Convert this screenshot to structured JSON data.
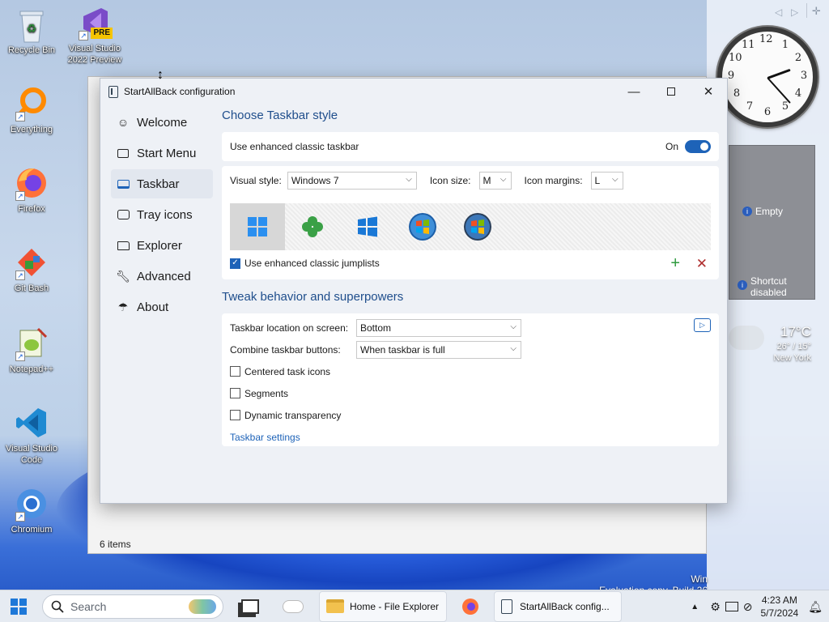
{
  "desktop": {
    "icons": [
      {
        "label": "Recycle Bin"
      },
      {
        "label": "Visual Studio 2022 Preview",
        "badge": "PRE"
      },
      {
        "label": "Everything"
      },
      {
        "label": "Firefox"
      },
      {
        "label": "Git Bash"
      },
      {
        "label": "Notepad++"
      },
      {
        "label": "Visual Studio Code"
      },
      {
        "label": "Chromium"
      }
    ],
    "watermark_line1": "Win",
    "watermark_line2": "Evaluation copy. Build 26"
  },
  "gadgets": {
    "clock_numbers": [
      "12",
      "1",
      "2",
      "3",
      "4",
      "5",
      "6",
      "7",
      "8",
      "9",
      "10",
      "11"
    ],
    "slideshow_empty": "Empty",
    "slideshow_shortcut": "Shortcut disabled",
    "weather_temp": "17°C",
    "weather_range": "26° / 15°",
    "weather_city": "New York"
  },
  "explorer_back": {
    "status": "6 items"
  },
  "window": {
    "title": "StartAllBack configuration",
    "nav": [
      {
        "label": "Welcome",
        "icon": "smiley-icon"
      },
      {
        "label": "Start Menu",
        "icon": "start-menu-icon"
      },
      {
        "label": "Taskbar",
        "icon": "taskbar-icon"
      },
      {
        "label": "Tray icons",
        "icon": "tray-icon"
      },
      {
        "label": "Explorer",
        "icon": "folder-icon"
      },
      {
        "label": "Advanced",
        "icon": "wrench-icon"
      },
      {
        "label": "About",
        "icon": "umbrella-icon"
      }
    ],
    "active_nav": "Taskbar",
    "section1_title": "Choose Taskbar style",
    "enhanced_label": "Use enhanced classic taskbar",
    "enhanced_state": "On",
    "visual_style_label": "Visual style:",
    "visual_style_value": "Windows 7",
    "icon_size_label": "Icon size:",
    "icon_size_value": "M",
    "icon_margins_label": "Icon margins:",
    "icon_margins_value": "L",
    "styles": [
      "Windows 11",
      "Clover",
      "Windows 10",
      "Windows 7",
      "Windows Vista"
    ],
    "selected_style": "Windows 11",
    "jumplists_label": "Use enhanced classic jumplists",
    "jumplists_checked": true,
    "section2_title": "Tweak behavior and superpowers",
    "location_label": "Taskbar location on screen:",
    "location_value": "Bottom",
    "combine_label": "Combine taskbar buttons:",
    "combine_value": "When taskbar is full",
    "centered_label": "Centered task icons",
    "segments_label": "Segments",
    "dynamic_label": "Dynamic transparency",
    "settings_link": "Taskbar settings"
  },
  "taskbar": {
    "search_placeholder": "Search",
    "explorer_label": "Home - File Explorer",
    "startallback_label": "StartAllBack config...",
    "time": "4:23 AM",
    "date": "5/7/2024"
  },
  "colors": {
    "accent": "#1e63b8",
    "title_blue": "#1f4e8c",
    "add_green": "#2e9a3e",
    "remove_red": "#b03030"
  }
}
